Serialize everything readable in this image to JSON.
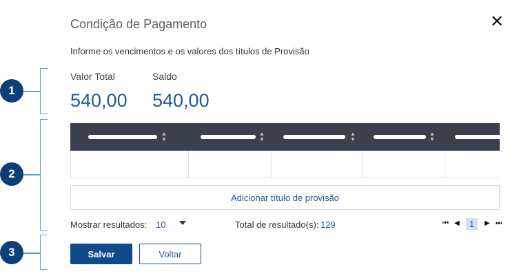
{
  "dialog": {
    "title": "Condição de Pagamento",
    "close_icon": "close-icon",
    "description": "Informe os vencimentos e os valores dos títulos de Provisão"
  },
  "totals": {
    "total_label": "Valor Total",
    "total_value": "540,00",
    "balance_label": "Saldo",
    "balance_value": "540,00"
  },
  "steps": [
    "1",
    "2",
    "3"
  ],
  "table": {
    "sort_icon": "sort-icon"
  },
  "add_row_label": "Adicionar título de provisão",
  "results": {
    "show_label": "Mostrar resultados:",
    "page_size": "10",
    "total_label": "Total de resultado(s):",
    "total_count": "129"
  },
  "pagination": {
    "first": "⏮",
    "prev": "◀",
    "current": "1",
    "next": "▶",
    "last": "⏭"
  },
  "buttons": {
    "save": "Salvar",
    "back": "Voltar"
  },
  "colors": {
    "accent": "#1f5a96",
    "primary_button": "#0f4a8a",
    "step_marker": "#0c3e78",
    "bracket": "#4aa3df",
    "table_header": "#3b3f4e"
  }
}
